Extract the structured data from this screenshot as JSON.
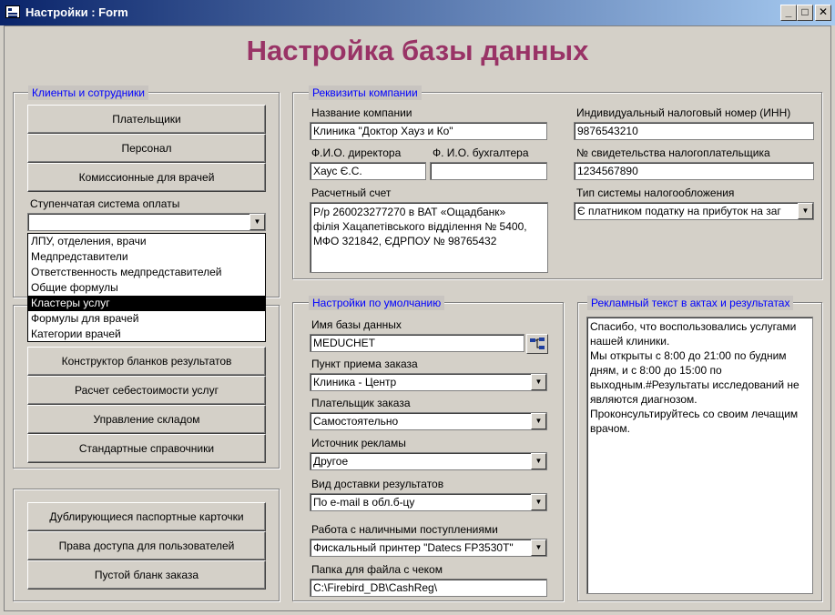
{
  "window": {
    "title": "Настройки : Form",
    "minimize": "_",
    "maximize": "□",
    "close": "✕"
  },
  "heading": "Настройка базы данных",
  "clients": {
    "legend": "Клиенты и сотрудники",
    "buttons": [
      "Плательщики",
      "Персонал",
      "Комиссионные для врачей"
    ],
    "payment_label": "Ступенчатая система оплаты",
    "payment_value": "",
    "dropdown_items": [
      "ЛПУ, отделения, врачи",
      "Медпредставители",
      "Ответственность медпредставителей",
      "Общие формулы",
      "Кластеры услуг",
      "Формулы для врачей",
      "Категории врачей"
    ],
    "selected_index": 4
  },
  "services": {
    "buttons": [
      "Конструктор бланков результатов",
      "Расчет себестоимости услуг",
      "Управление складом",
      "Стандартные справочники"
    ]
  },
  "misc": {
    "buttons": [
      "Дублирующиеся паспортные карточки",
      "Права доступа для пользователей",
      "Пустой бланк заказа"
    ]
  },
  "company": {
    "legend": "Реквизиты компании",
    "name_label": "Название компании",
    "name_value": "Клиника \"Доктор Хауз и Ко\"",
    "director_label": "Ф.И.О. директора",
    "director_value": "Хаус Є.С.",
    "accountant_label": "Ф. И.О. бухгалтера",
    "accountant_value": "",
    "account_label": "Расчетный счет",
    "account_value": "Р/р 260023277270 в ВАТ «Ощадбанк»\nфілія Хацапетівського відділення № 5400,\nМФО 321842, ЄДРПОУ № 98765432",
    "inn_label": "Индивидуальный налоговый номер (ИНН)",
    "inn_value": "9876543210",
    "cert_label": "№ свидетельства налогоплательщика",
    "cert_value": "1234567890",
    "tax_label": "Тип системы налогообложения",
    "tax_value": "Є платником податку на прибуток на заг"
  },
  "defaults": {
    "legend": "Настройки по умолчанию",
    "db_label": "Имя базы данных",
    "db_value": "MEDUCHET",
    "point_label": "Пункт приема заказа",
    "point_value": "Клиника - Центр",
    "payer_label": "Плательщик заказа",
    "payer_value": "Самостоятельно",
    "ad_label": "Источник рекламы",
    "ad_value": "Другое",
    "delivery_label": "Вид доставки результатов",
    "delivery_value": "По e-mail в обл.б-цу",
    "cash_label": "Работа с наличными поступлениями",
    "cash_value": "Фискальный принтер \"Datecs FP3530T\"",
    "folder_label": "Папка для файла с чеком",
    "folder_value": "C:\\Firebird_DB\\CashReg\\"
  },
  "ad_text": {
    "legend": "Рекламный текст в актах и результатах",
    "value": "Спасибо, что воспользовались услугами нашей клиники.\nМы открыты с 8:00 до 21:00 по будним дням, и с 8:00 до 15:00 по выходным.#Результаты исследований не являются диагнозом.\nПроконсультируйтесь со своим лечащим врачом."
  },
  "icons": {
    "dropdown": "chevron-down-icon",
    "browse": "tree-icon",
    "app": "form-icon"
  }
}
